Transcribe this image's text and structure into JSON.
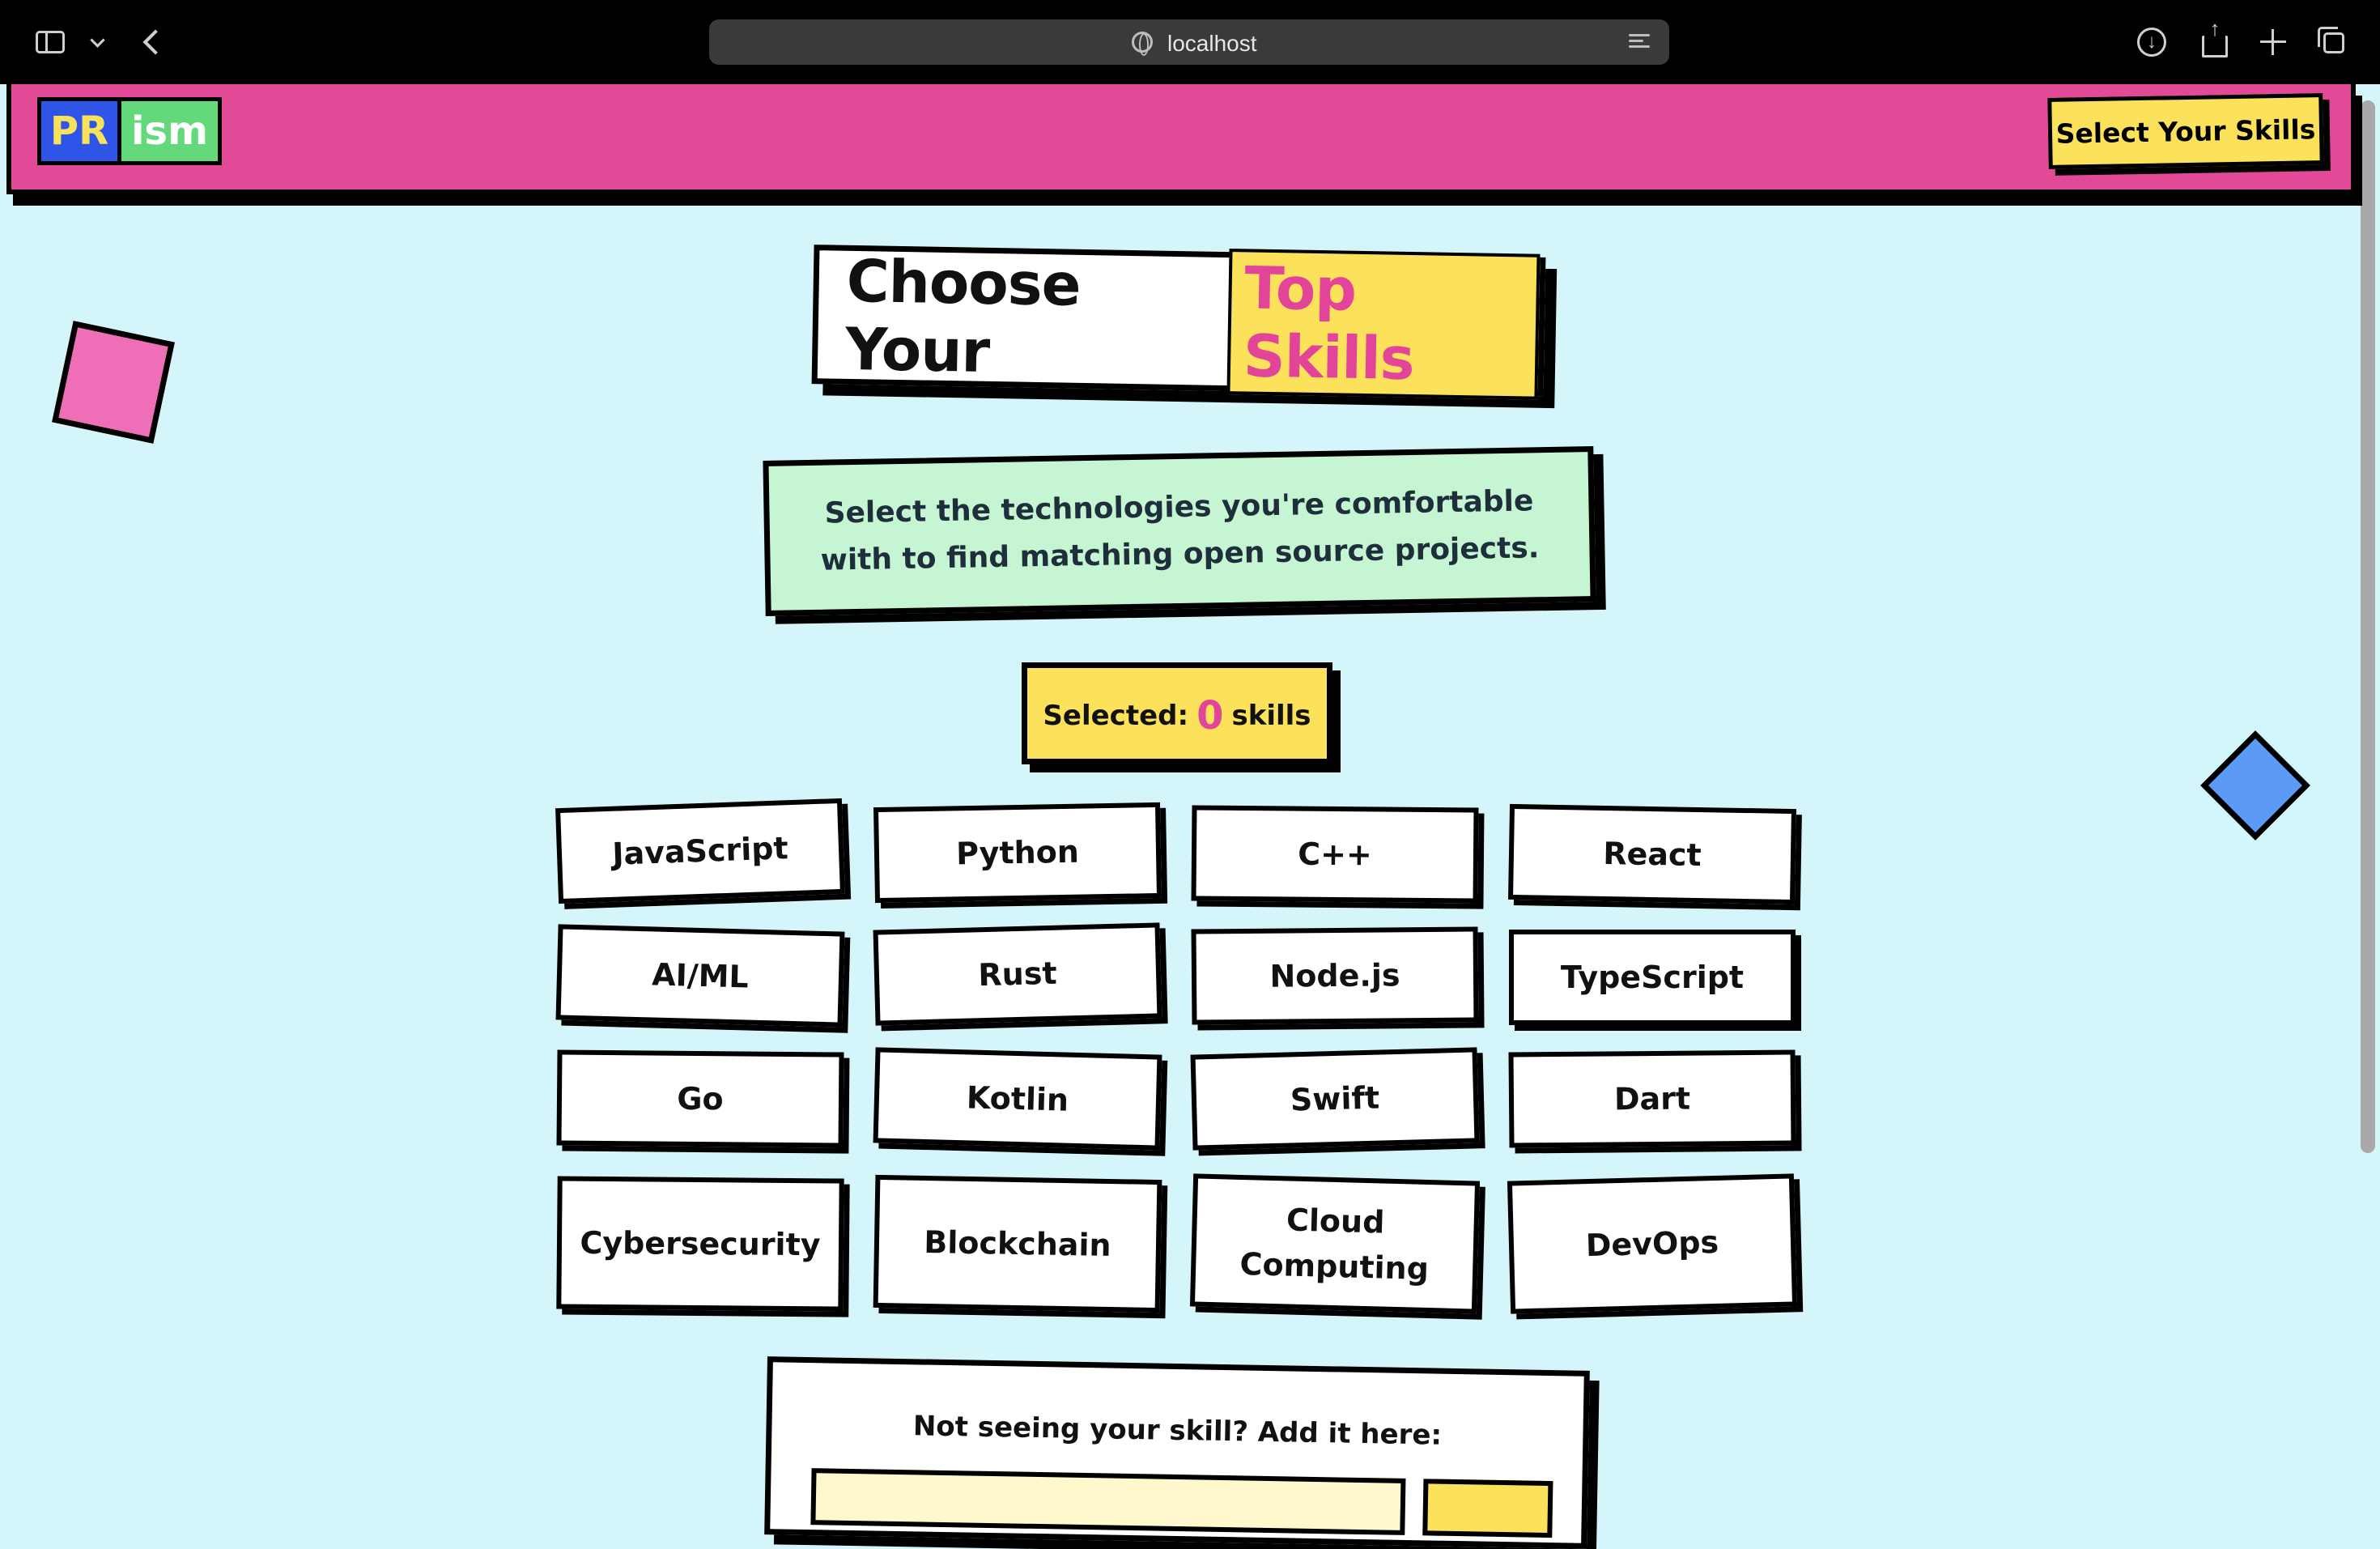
{
  "browser": {
    "url": "localhost"
  },
  "header": {
    "logo_left": "PR",
    "logo_right": "ism",
    "nav_button": "Select Your Skills"
  },
  "hero": {
    "title_prefix": "Choose Your",
    "title_highlight": "Top Skills",
    "subtitle": "Select the technologies you're comfortable with to find matching open source projects."
  },
  "counter": {
    "label": "Selected:",
    "count": "0",
    "suffix": "skills"
  },
  "skills": [
    "JavaScript",
    "Python",
    "C++",
    "React",
    "AI/ML",
    "Rust",
    "Node.js",
    "TypeScript",
    "Go",
    "Kotlin",
    "Swift",
    "Dart",
    "Cybersecurity",
    "Blockchain",
    "Cloud Computing",
    "DevOps"
  ],
  "add_skill": {
    "label": "Not seeing your skill? Add it here:"
  },
  "colors": {
    "page_bg": "#d4f6fb",
    "header_pink": "#e24a98",
    "accent_yellow": "#fbe25a",
    "accent_green": "#c6f5d3",
    "accent_blue": "#2f55e8",
    "highlight_pink": "#e2449a"
  }
}
